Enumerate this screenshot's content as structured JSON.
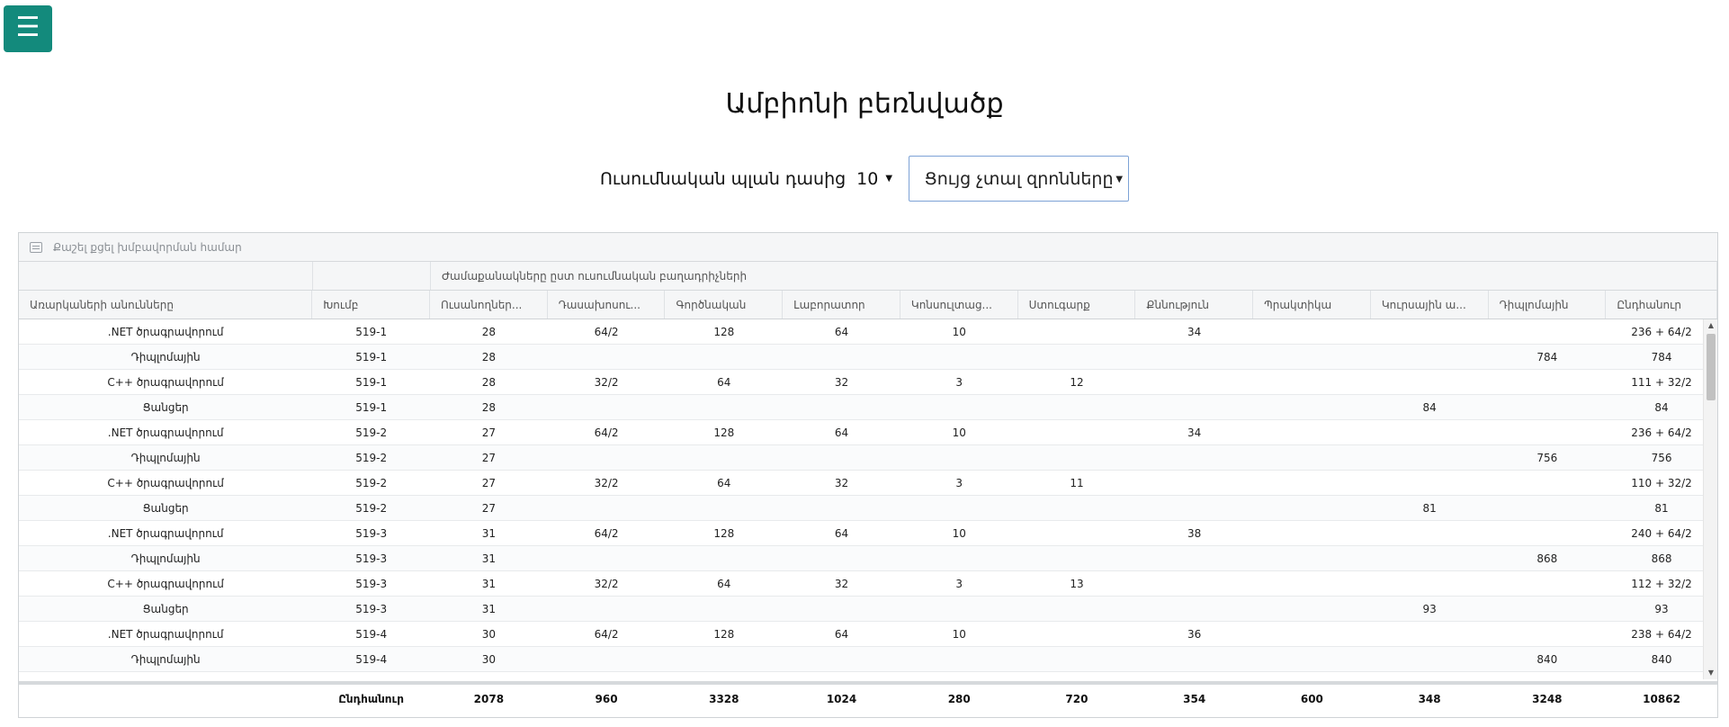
{
  "menu": {
    "icon": "☰"
  },
  "page_title": "Ամբիոնի բեռնվածք",
  "controls": {
    "plan_label": "Ուսումնական պլան դասից",
    "year_value": "10",
    "hide_select_value": "Ցույց չտալ զրոնները"
  },
  "grid": {
    "group_panel_text": "Քաշել քցել խմբավորման համար",
    "band_title": "Ժամաքանակները ըստ ուսումնական բաղադրիչների",
    "columns": [
      "Առարկաների անունները",
      "Խումբ",
      "Ուսանողներ...",
      "Դասախոսու...",
      "Գործնական",
      "Լաբորատոր",
      "Կոնսուլտաց...",
      "Ստուգարք",
      "Քննություն",
      "Պրակտիկա",
      "Կուրսային ա...",
      "Դիպլոմային",
      "Ընդհանուր"
    ],
    "rows": [
      [
        ".NET ծրագրավորում",
        "519-1",
        "28",
        "64/2",
        "128",
        "64",
        "10",
        "",
        "34",
        "",
        "",
        "",
        "236 + 64/2"
      ],
      [
        "Դիպլոմային",
        "519-1",
        "28",
        "",
        "",
        "",
        "",
        "",
        "",
        "",
        "",
        "784",
        "784"
      ],
      [
        "C++ ծրագրավորում",
        "519-1",
        "28",
        "32/2",
        "64",
        "32",
        "3",
        "12",
        "",
        "",
        "",
        "",
        "111 + 32/2"
      ],
      [
        "Ցանցեր",
        "519-1",
        "28",
        "",
        "",
        "",
        "",
        "",
        "",
        "",
        "84",
        "",
        "84"
      ],
      [
        ".NET ծրագրավորում",
        "519-2",
        "27",
        "64/2",
        "128",
        "64",
        "10",
        "",
        "34",
        "",
        "",
        "",
        "236 + 64/2"
      ],
      [
        "Դիպլոմային",
        "519-2",
        "27",
        "",
        "",
        "",
        "",
        "",
        "",
        "",
        "",
        "756",
        "756"
      ],
      [
        "C++ ծրագրավորում",
        "519-2",
        "27",
        "32/2",
        "64",
        "32",
        "3",
        "11",
        "",
        "",
        "",
        "",
        "110 + 32/2"
      ],
      [
        "Ցանցեր",
        "519-2",
        "27",
        "",
        "",
        "",
        "",
        "",
        "",
        "",
        "81",
        "",
        "81"
      ],
      [
        ".NET ծրագրավորում",
        "519-3",
        "31",
        "64/2",
        "128",
        "64",
        "10",
        "",
        "38",
        "",
        "",
        "",
        "240 + 64/2"
      ],
      [
        "Դիպլոմային",
        "519-3",
        "31",
        "",
        "",
        "",
        "",
        "",
        "",
        "",
        "",
        "868",
        "868"
      ],
      [
        "C++ ծրագրավորում",
        "519-3",
        "31",
        "32/2",
        "64",
        "32",
        "3",
        "13",
        "",
        "",
        "",
        "",
        "112 + 32/2"
      ],
      [
        "Ցանցեր",
        "519-3",
        "31",
        "",
        "",
        "",
        "",
        "",
        "",
        "",
        "93",
        "",
        "93"
      ],
      [
        ".NET ծրագրավորում",
        "519-4",
        "30",
        "64/2",
        "128",
        "64",
        "10",
        "",
        "36",
        "",
        "",
        "",
        "238 + 64/2"
      ],
      [
        "Դիպլոմային",
        "519-4",
        "30",
        "",
        "",
        "",
        "",
        "",
        "",
        "",
        "",
        "840",
        "840"
      ]
    ],
    "totals": [
      "",
      "Ընդհանուր",
      "2078",
      "960",
      "3328",
      "1024",
      "280",
      "720",
      "354",
      "600",
      "348",
      "3248",
      "10862"
    ]
  }
}
